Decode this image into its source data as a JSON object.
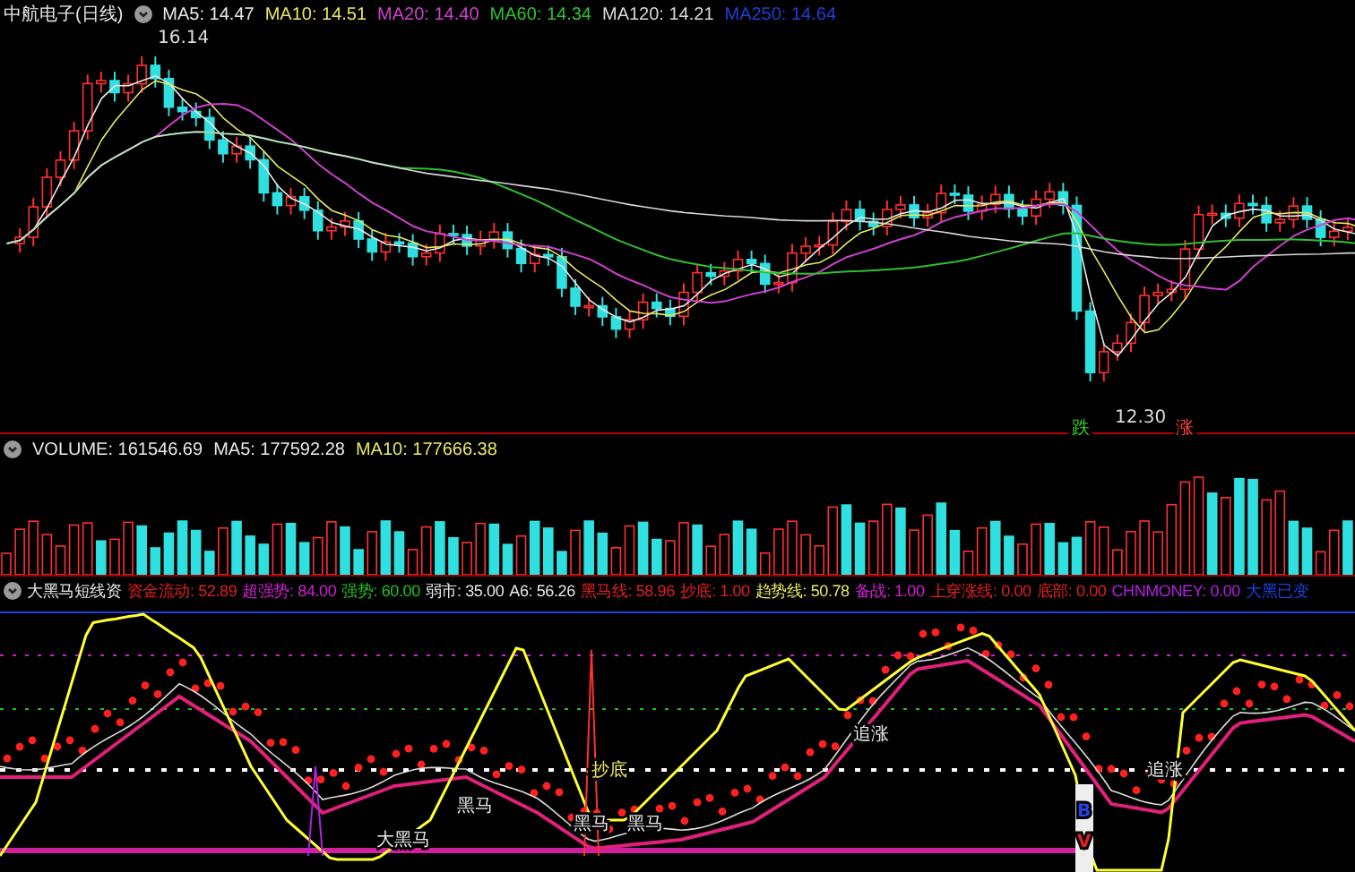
{
  "main_panel": {
    "title": "中航电子(日线)",
    "legend": [
      {
        "label": "MA5: 14.47",
        "color": "#e8e8e8"
      },
      {
        "label": "MA10: 14.51",
        "color": "#e8e860"
      },
      {
        "label": "MA20: 14.40",
        "color": "#d040d0"
      },
      {
        "label": "MA60: 14.34",
        "color": "#30c030"
      },
      {
        "label": "MA120: 14.21",
        "color": "#d8d8d8"
      },
      {
        "label": "MA250: 14.64",
        "color": "#2040d0"
      }
    ],
    "annotations": [
      {
        "text": "16.14",
        "kind": "high"
      },
      {
        "text": "12.30",
        "kind": "low"
      }
    ],
    "signals": [
      {
        "text": "跌",
        "kind": "down"
      },
      {
        "text": "涨",
        "kind": "up"
      }
    ]
  },
  "volume_panel": {
    "legend": [
      {
        "label": "VOLUME: 161546.69",
        "color": "#e8e8e8"
      },
      {
        "label": "MA5: 177592.28",
        "color": "#e8e8e8"
      },
      {
        "label": "MA10: 177666.38",
        "color": "#e8e860"
      }
    ]
  },
  "indicator_panel": {
    "title": "大黑马短线资",
    "legend": [
      {
        "label": "资金流动: 52.89",
        "color": "#e02020"
      },
      {
        "label": "超强势: 84.00",
        "color": "#d020d0"
      },
      {
        "label": "强势: 60.00",
        "color": "#20c020"
      },
      {
        "label": "弱市: 35.00",
        "color": "#e8e8e8"
      },
      {
        "label": "A6: 56.26",
        "color": "#e8e8e8"
      },
      {
        "label": "黑马线: 58.96",
        "color": "#e02020"
      },
      {
        "label": "抄底: 1.00",
        "color": "#e02020"
      },
      {
        "label": "趋势线: 50.78",
        "color": "#e8e860"
      },
      {
        "label": "备战: 1.00",
        "color": "#d020d0"
      },
      {
        "label": "上穿涨线: 0.00",
        "color": "#e02020"
      },
      {
        "label": "底部: 0.00",
        "color": "#e02020"
      },
      {
        "label": "CHNMONEY: 0.00",
        "color": "#b020e0"
      },
      {
        "label": "大黑已变",
        "color": "#2040e0"
      }
    ],
    "labels": [
      {
        "text": "大黑马",
        "kind": "white"
      },
      {
        "text": "黑马",
        "kind": "white"
      },
      {
        "text": "抄底",
        "kind": "yellow"
      },
      {
        "text": "黑马",
        "kind": "white"
      },
      {
        "text": "黑马",
        "kind": "white"
      },
      {
        "text": "追涨",
        "kind": "white"
      },
      {
        "text": "追涨",
        "kind": "white"
      }
    ],
    "badge": [
      "B",
      "V"
    ]
  }
}
